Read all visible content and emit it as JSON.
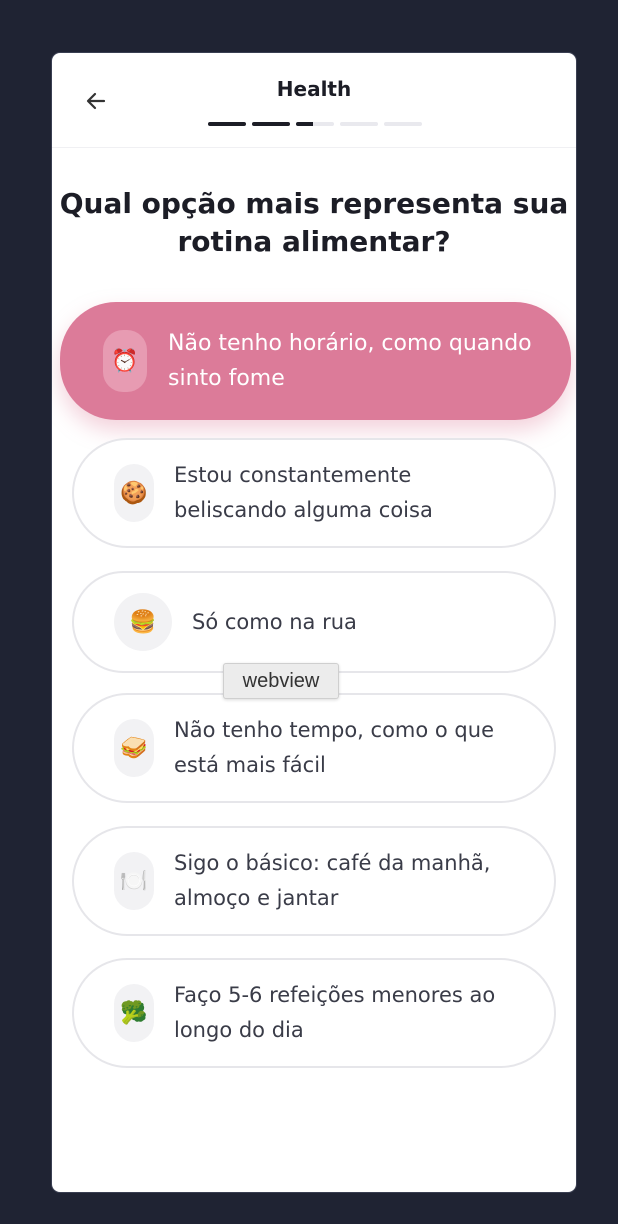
{
  "header": {
    "title": "Health",
    "back_icon": "arrow-left-icon",
    "progress": [
      1,
      1,
      0.45,
      0,
      0
    ]
  },
  "question": "Qual opção mais representa sua rotina alimentar?",
  "options": [
    {
      "emoji": "⏰",
      "icon": "alarm-clock-icon",
      "label": "Não tenho horário, como quando sinto fome",
      "selected": true
    },
    {
      "emoji": "🍪",
      "icon": "cookie-icon",
      "label": "Estou constantemente beliscando alguma coisa",
      "selected": false
    },
    {
      "emoji": "🍔",
      "icon": "burger-icon",
      "label": "Só como na rua",
      "selected": false
    },
    {
      "emoji": "🥪",
      "icon": "sandwich-icon",
      "label": "Não tenho tempo, como o que está mais fácil",
      "selected": false
    },
    {
      "emoji": "🍽️",
      "icon": "plate-cutlery-icon",
      "label": "Sigo o básico: café da manhã, almoço e jantar",
      "selected": false
    },
    {
      "emoji": "🥦",
      "icon": "broccoli-icon",
      "label": "Faço 5-6 refeições menores ao longo do dia",
      "selected": false
    }
  ],
  "tooltip": "webview",
  "colors": {
    "background": "#1f2333",
    "selected": "#dc7b99",
    "text_dark": "#1c1d26"
  }
}
